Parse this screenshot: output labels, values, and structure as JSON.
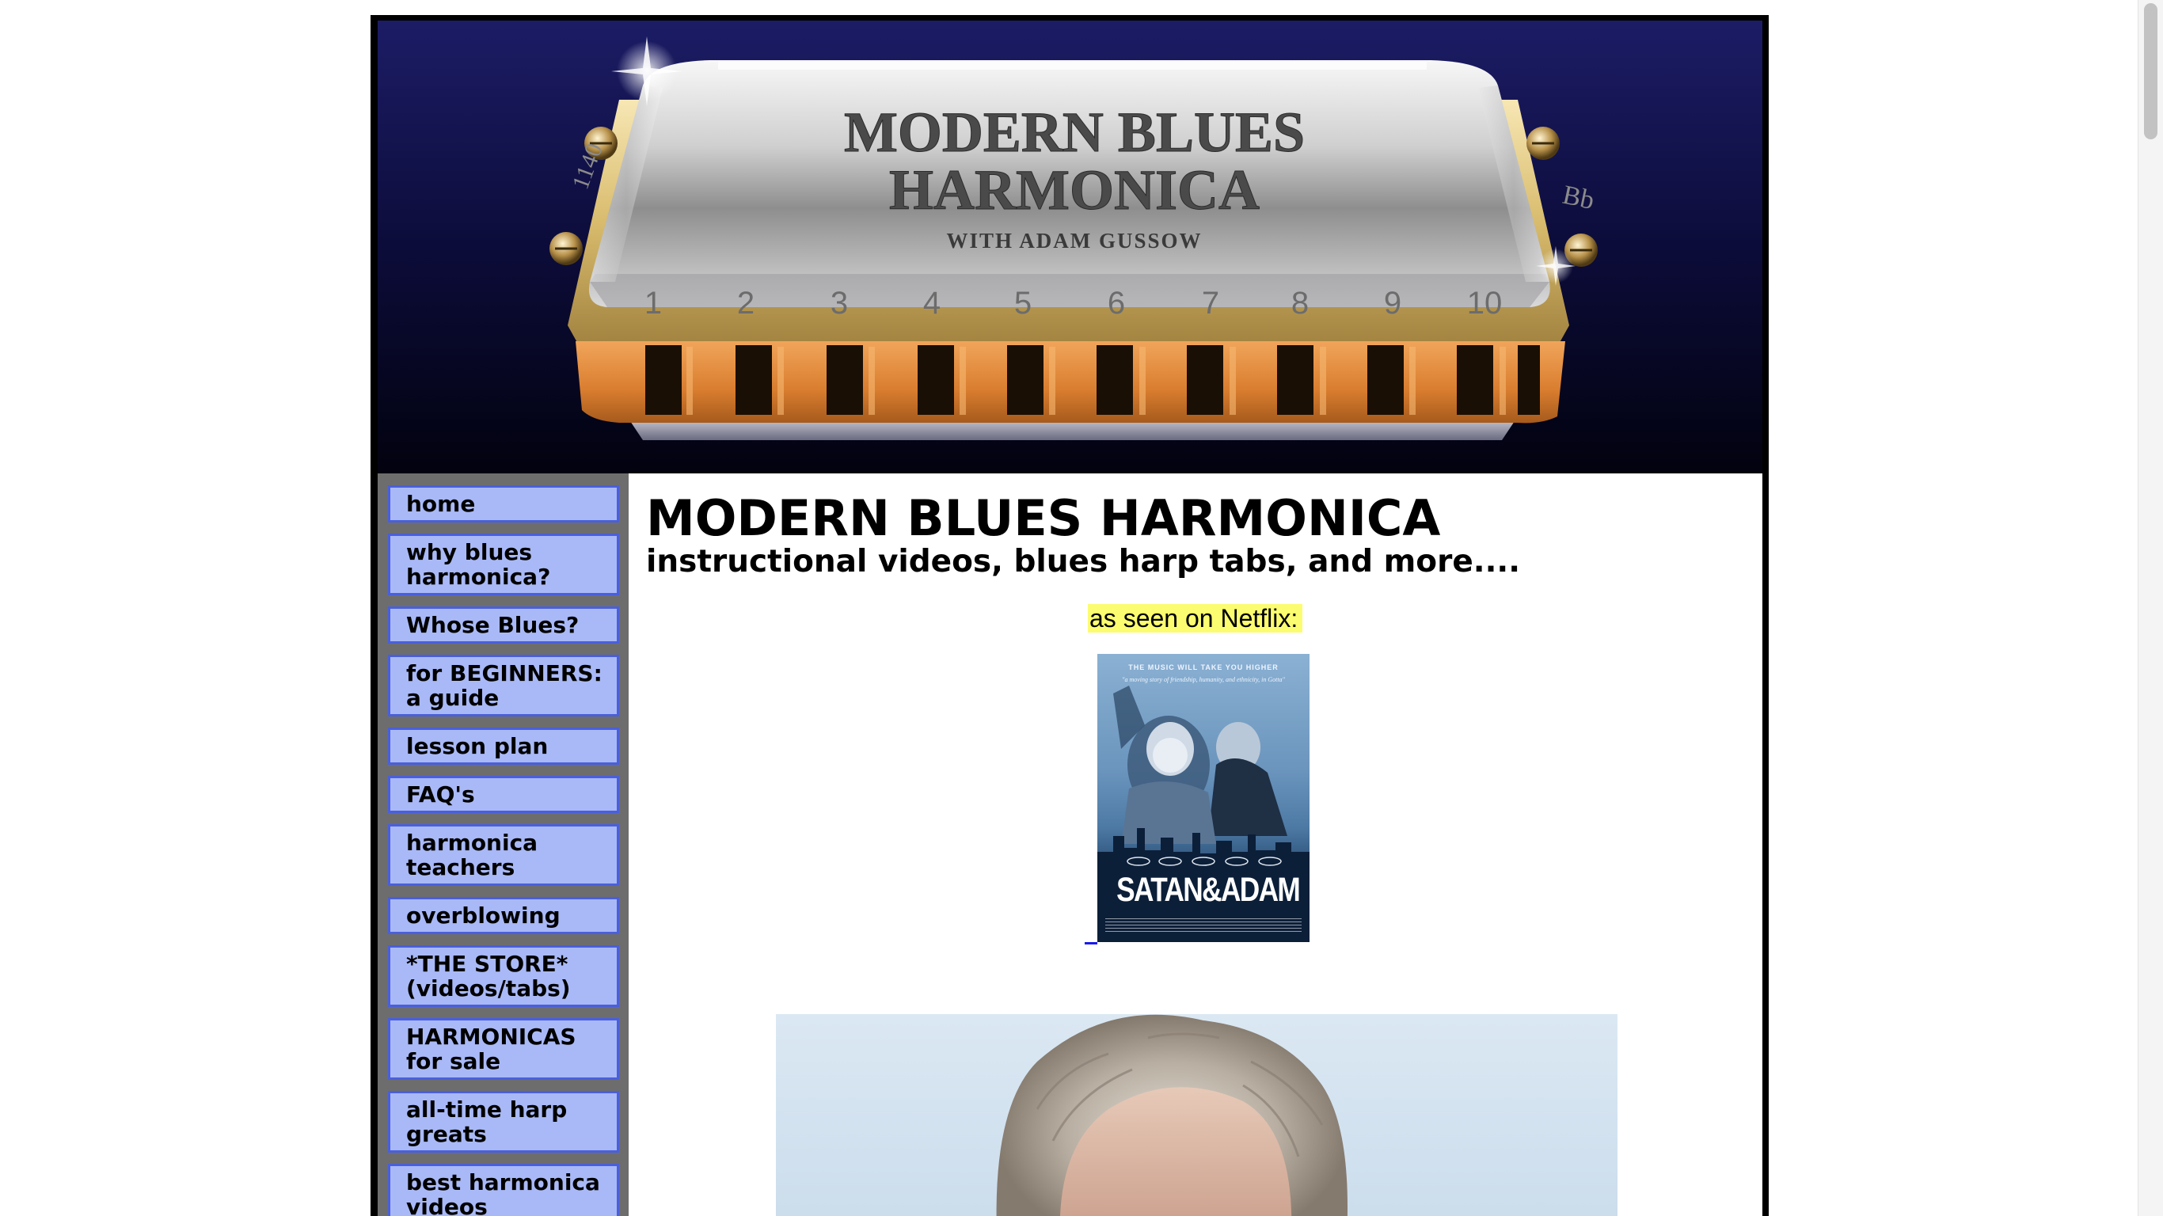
{
  "banner": {
    "title_line1": "MODERN BLUES",
    "title_line2": "HARMONICA",
    "byline": "WITH ADAM GUSSOW",
    "hole_numbers": [
      "1",
      "2",
      "3",
      "4",
      "5",
      "6",
      "7",
      "8",
      "9",
      "10"
    ],
    "key_left": "1140",
    "key_right": "Bb",
    "logo_name": "harmonica-banner-logo"
  },
  "sidebar": {
    "items": [
      {
        "line1": "home",
        "line2": ""
      },
      {
        "line1": "why blues",
        "line2": "harmonica?"
      },
      {
        "line1": "Whose Blues?",
        "line2": ""
      },
      {
        "line1": "for BEGINNERS:",
        "line2": "a guide"
      },
      {
        "line1": "lesson plan",
        "line2": ""
      },
      {
        "line1": "FAQ's",
        "line2": ""
      },
      {
        "line1": "harmonica",
        "line2": "teachers"
      },
      {
        "line1": "overblowing",
        "line2": ""
      },
      {
        "line1": "*THE STORE*",
        "line2": "(videos/tabs)"
      },
      {
        "line1": "HARMONICAS",
        "line2": "for sale"
      },
      {
        "line1": "all-time harp",
        "line2": "greats"
      },
      {
        "line1": "best harmonica",
        "line2": "videos"
      }
    ]
  },
  "main": {
    "title": "MODERN BLUES HARMONICA",
    "subtitle": "instructional videos, blues harp tabs, and more....",
    "netflix_note": "as seen on Netflix:",
    "poster": {
      "tagline": "THE MUSIC WILL TAKE YOU HIGHER",
      "quote": "\"a moving story of friendship, humanity, and ethnicity, in Gotta\"",
      "title": "SATAN&ADAM"
    },
    "photo_name": "adam-gussow-portrait"
  },
  "colors": {
    "nav_fill": "#a9b9f7",
    "nav_border": "#4a5fdc",
    "sidebar_bg": "#6d6d6d",
    "highlight": "#fcfc70",
    "frame": "#000000"
  }
}
